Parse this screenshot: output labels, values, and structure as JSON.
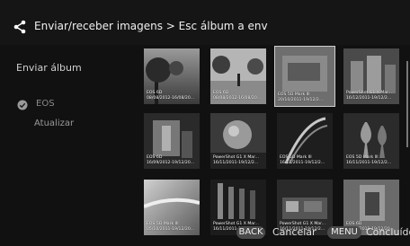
{
  "header": {
    "title": "Enviar/receber imagens > Esc álbum a env"
  },
  "sidebar": {
    "title": "Enviar álbum",
    "items": [
      {
        "label": "EOS",
        "checked": true
      },
      {
        "label": "Atualizar"
      }
    ]
  },
  "thumbnails": [
    {
      "caption1": "EOS 6D",
      "caption2": "08/08/2012-16/08/20...",
      "selected": false
    },
    {
      "caption1": "EOS 6D",
      "caption2": "08/08/2012-16/08/20...",
      "selected": false
    },
    {
      "caption1": "EOS 5D Mark III",
      "caption2": "20/10/2011-19/12/2...",
      "selected": true
    },
    {
      "caption1": "PowerShot G1 X Mar...",
      "caption2": "16/12/2011-19/12/2...",
      "selected": false
    },
    {
      "caption1": "EOS 6D",
      "caption2": "16/09/2012-19/12/20...",
      "selected": false
    },
    {
      "caption1": "PowerShot G1 X Mar...",
      "caption2": "16/11/2011-19/12/2...",
      "selected": false
    },
    {
      "caption1": "EOS 5D Mark III",
      "caption2": "16/11/2011-19/12/2...",
      "selected": false
    },
    {
      "caption1": "EOS 5D Mark III",
      "caption2": "16/11/2011-19/12/2...",
      "selected": false
    },
    {
      "caption1": "EOS 5D Mark III",
      "caption2": "05/10/2011-19/12/20...",
      "selected": false
    },
    {
      "caption1": "PowerShot G1 X Mar...",
      "caption2": "16/11/2011-19/12/2...",
      "selected": false
    },
    {
      "caption1": "PowerShot G1 X Mar...",
      "caption2": "16/11/2011-19/12/2...",
      "selected": false
    },
    {
      "caption1": "EOS 6D",
      "caption2": "16/11/2011-19/12/20...",
      "selected": false
    }
  ],
  "footer": {
    "back_key": "BACK",
    "back_label": "Cancelar",
    "menu_key": "MENU",
    "menu_label": "Concluído"
  },
  "icons": {
    "header": "share-icon",
    "check": "check-circle-icon"
  },
  "colors": {
    "background": "#111111",
    "pill": "#4a4a4a",
    "check": "#9a9a9a"
  }
}
